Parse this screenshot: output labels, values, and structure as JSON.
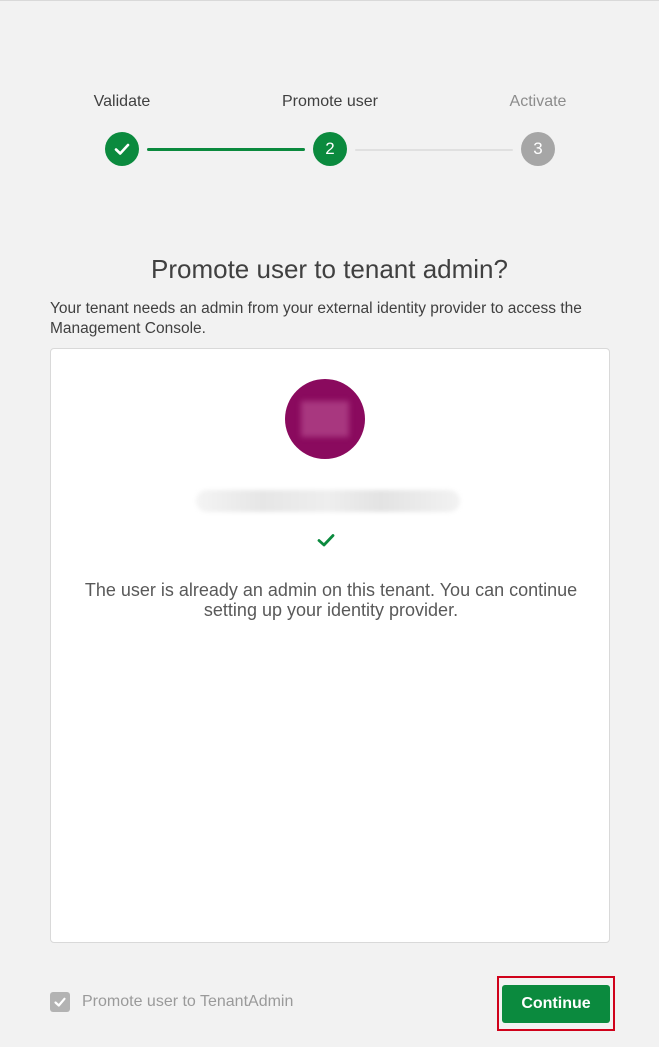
{
  "stepper": {
    "steps": [
      {
        "label": "Validate",
        "number": "1",
        "state": "done"
      },
      {
        "label": "Promote user",
        "number": "2",
        "state": "current"
      },
      {
        "label": "Activate",
        "number": "3",
        "state": "future"
      }
    ]
  },
  "dialog": {
    "title": "Promote user to tenant admin?",
    "description": "Your tenant needs an admin from your external identity provider to access the Management Console."
  },
  "user_card": {
    "status_message": "The user is already an admin on this tenant. You can continue setting up your identity provider."
  },
  "footer": {
    "checkbox_label": "Promote user to TenantAdmin",
    "checkbox_checked": true,
    "checkbox_disabled": true,
    "continue_label": "Continue"
  },
  "colors": {
    "accent": "#0b8a3e",
    "avatar": "#8a0a5e",
    "inactive": "#a6a6a6",
    "highlight_border": "#d0021b"
  }
}
